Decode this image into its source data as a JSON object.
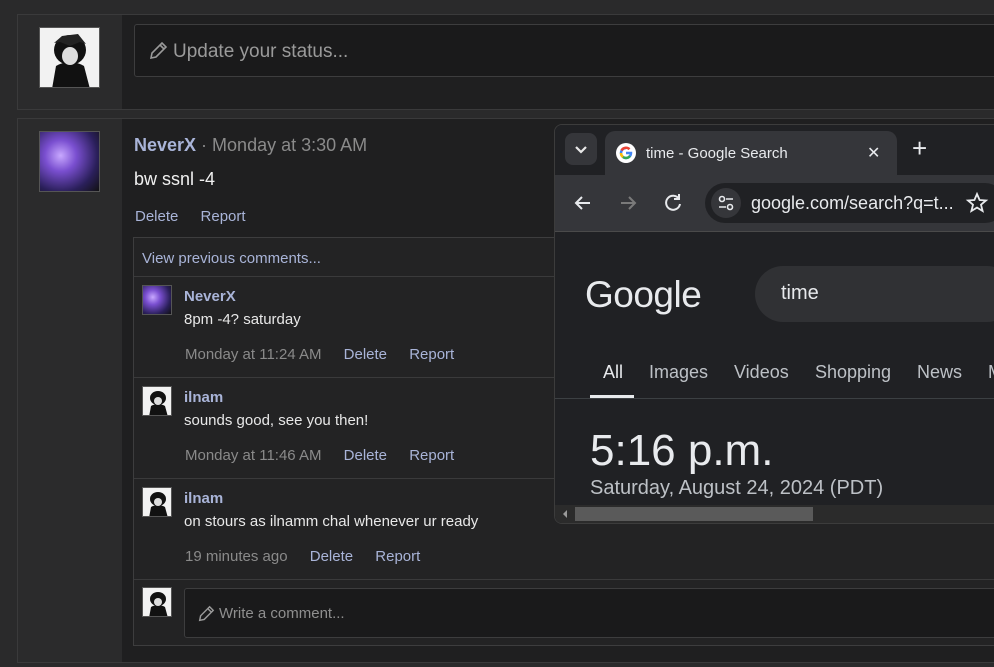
{
  "status": {
    "placeholder": "Update your status..."
  },
  "post": {
    "author": "NeverX",
    "separator": " · ",
    "time": "Monday at 3:30 AM",
    "text": "bw ssnl -4",
    "delete_label": "Delete",
    "report_label": "Report"
  },
  "comments": {
    "view_previous": "View previous comments...",
    "items": [
      {
        "author": "NeverX",
        "text": "8pm -4? saturday",
        "time": "Monday at 11:24 AM",
        "delete": "Delete",
        "report": "Report"
      },
      {
        "author": "ilnam",
        "text": "sounds good, see you then!",
        "time": "Monday at 11:46 AM",
        "delete": "Delete",
        "report": "Report"
      },
      {
        "author": "ilnam",
        "text": "on stours as ilnamm chal whenever ur ready",
        "time": "19 minutes ago",
        "delete": "Delete",
        "report": "Report"
      }
    ],
    "write_placeholder": "Write a comment..."
  },
  "browser": {
    "tab_title": "time - Google Search",
    "new_tab": "+",
    "close_tab": "✕",
    "url": "google.com/search?q=t...",
    "google_logo": "Google",
    "query": "time",
    "tabs": [
      "All",
      "Images",
      "Videos",
      "Shopping",
      "News",
      "M"
    ],
    "result_time": "5:16 p.m.",
    "result_date": "Saturday, August 24, 2024 (PDT)"
  }
}
